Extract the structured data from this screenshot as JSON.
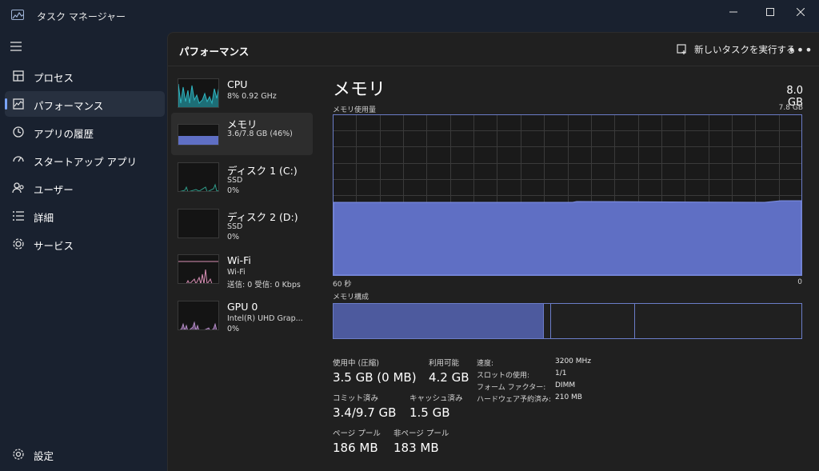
{
  "window": {
    "title": "タスク マネージャー",
    "controls": {
      "minimize": "minimize",
      "maximize": "maximize",
      "close": "close"
    }
  },
  "nav": {
    "items": [
      {
        "label": "プロセス",
        "icon": "processes-icon"
      },
      {
        "label": "パフォーマンス",
        "icon": "performance-icon",
        "active": true
      },
      {
        "label": "アプリの履歴",
        "icon": "history-icon"
      },
      {
        "label": "スタートアップ アプリ",
        "icon": "startup-icon"
      },
      {
        "label": "ユーザー",
        "icon": "users-icon"
      },
      {
        "label": "詳細",
        "icon": "details-icon"
      },
      {
        "label": "サービス",
        "icon": "services-icon"
      }
    ],
    "settings_label": "設定"
  },
  "header": {
    "title": "パフォーマンス",
    "new_task_label": "新しいタスクを実行する",
    "more_label": "•••"
  },
  "resources": [
    {
      "name": "CPU",
      "line2": "8%  0.92 GHz",
      "line3": ""
    },
    {
      "name": "メモリ",
      "line2": "3.6/7.8 GB (46%)",
      "line3": ""
    },
    {
      "name": "ディスク 1 (C:)",
      "line2": "SSD",
      "line3": "0%"
    },
    {
      "name": "ディスク 2 (D:)",
      "line2": "SSD",
      "line3": "0%"
    },
    {
      "name": "Wi-Fi",
      "line2": "Wi-Fi",
      "line3": "送信: 0 受信: 0 Kbps"
    },
    {
      "name": "GPU 0",
      "line2": "Intel(R) UHD Grap...",
      "line3": "0%"
    }
  ],
  "memory": {
    "title": "メモリ",
    "total": "8.0 GB",
    "usage_label": "メモリ使用量",
    "usage_max": "7.8 GB",
    "x_left": "60 秒",
    "x_right": "0",
    "composition_label": "メモリ構成",
    "usage_fraction": 0.46,
    "composition": {
      "in_use_fraction": 0.45,
      "modified_fraction": 0.015,
      "standby_fraction": 0.18
    },
    "stats": {
      "in_use_label": "使用中 (圧縮)",
      "in_use_value": "3.5 GB (0 MB)",
      "available_label": "利用可能",
      "available_value": "4.2 GB",
      "committed_label": "コミット済み",
      "committed_value": "3.4/9.7 GB",
      "cached_label": "キャッシュ済み",
      "cached_value": "1.5 GB",
      "paged_label": "ページ プール",
      "paged_value": "186 MB",
      "nonpaged_label": "非ページ プール",
      "nonpaged_value": "183 MB"
    },
    "specs": [
      {
        "key": "速度:",
        "value": "3200 MHz"
      },
      {
        "key": "スロットの使用:",
        "value": "1/1"
      },
      {
        "key": "フォーム ファクター:",
        "value": "DIMM"
      },
      {
        "key": "ハードウェア予約済み:",
        "value": "210 MB"
      }
    ]
  },
  "colors": {
    "accent": "#7aa4ff",
    "memory_fill": "#5f6fc4",
    "memory_line": "#7b8ce0",
    "cpu": "#2fb5c0",
    "disk": "#2f9c8a",
    "network": "#d88fb5",
    "gpu": "#c49ad6"
  }
}
